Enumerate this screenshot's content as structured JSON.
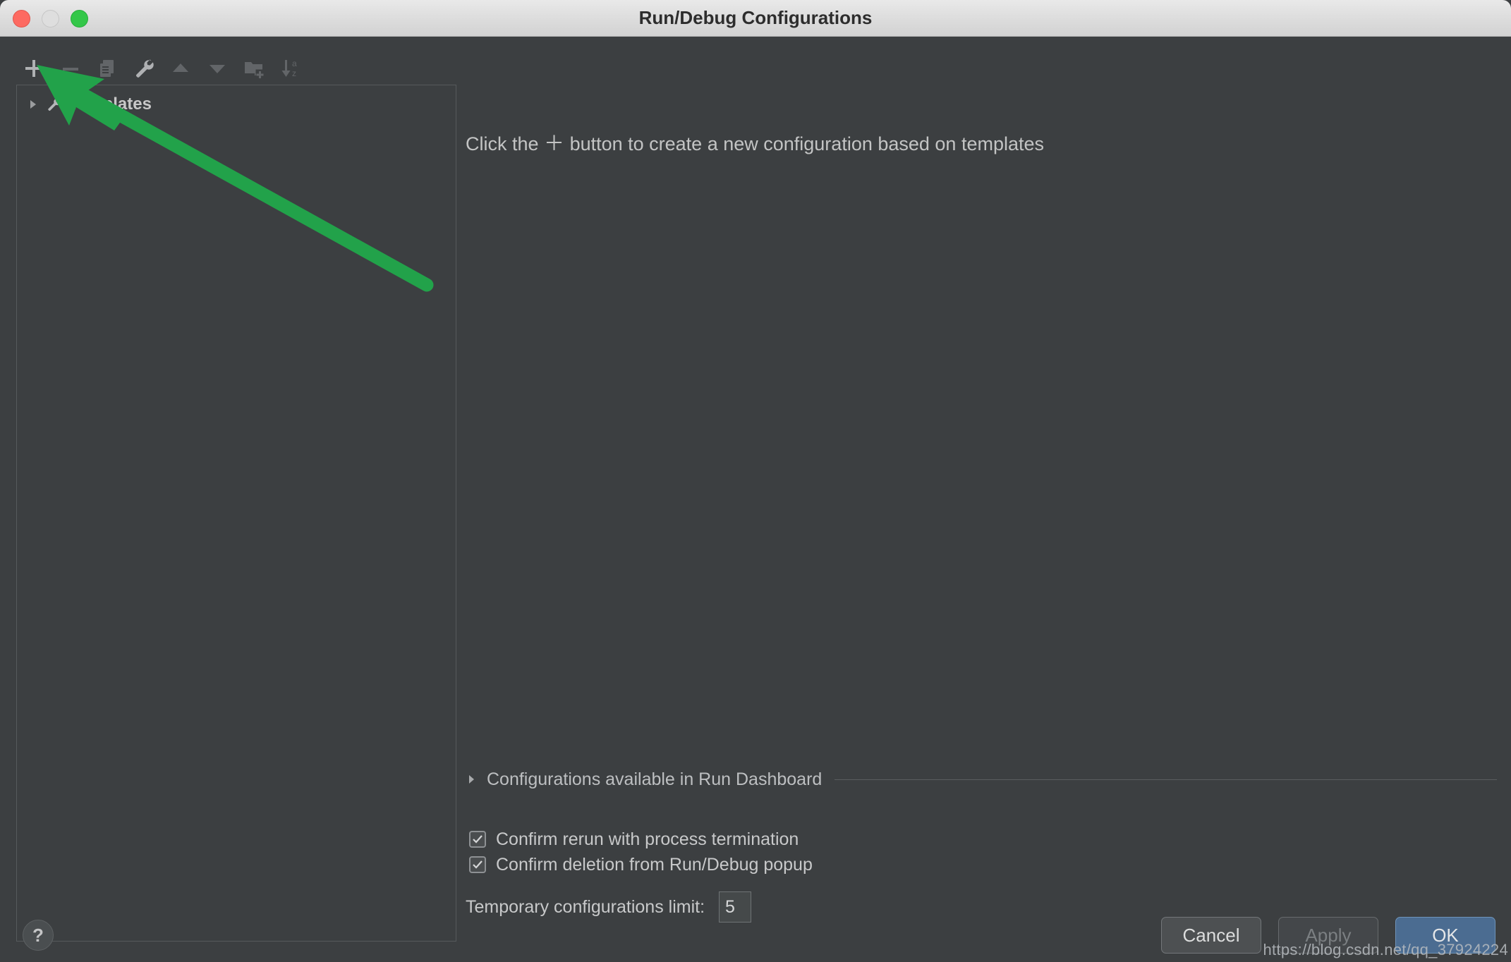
{
  "window": {
    "title": "Run/Debug Configurations",
    "traffic_lights": [
      "close-red",
      "minimize-grey",
      "maximize-green"
    ]
  },
  "toolbar": {
    "items": [
      {
        "name": "add-configuration-button",
        "icon": "plus-icon",
        "label": "+",
        "enabled": true
      },
      {
        "name": "remove-configuration-button",
        "icon": "minus-icon",
        "label": "−",
        "enabled": false
      },
      {
        "name": "copy-configuration-button",
        "icon": "copy-icon",
        "label": "Copy",
        "enabled": false
      },
      {
        "name": "edit-templates-button",
        "icon": "wrench-icon",
        "label": "Edit Templates",
        "enabled": true
      },
      {
        "name": "move-up-button",
        "icon": "triangle-up-icon",
        "label": "Move Up",
        "enabled": false
      },
      {
        "name": "move-down-button",
        "icon": "triangle-down-icon",
        "label": "Move Down",
        "enabled": false
      },
      {
        "name": "new-folder-button",
        "icon": "folder-add-icon",
        "label": "New Folder",
        "enabled": false
      },
      {
        "name": "sort-button",
        "icon": "sort-az-icon",
        "label": "Sort Configurations",
        "enabled": false
      }
    ]
  },
  "tree": {
    "items": [
      {
        "label": "Templates",
        "expanded": false,
        "icon": "wrench-icon"
      }
    ]
  },
  "main": {
    "hint_prefix": "Click the ",
    "hint_plus": "＋",
    "hint_suffix": " button to create a new configuration based on templates"
  },
  "dashboard_section": {
    "label": "Configurations available in Run Dashboard",
    "expanded": false
  },
  "options": {
    "checkboxes": [
      {
        "label": "Confirm rerun with process termination",
        "checked": true
      },
      {
        "label": "Confirm deletion from Run/Debug popup",
        "checked": true
      }
    ],
    "temporary_limit_label": "Temporary configurations limit:",
    "temporary_limit_value": "5"
  },
  "footer": {
    "help_glyph": "?",
    "cancel_label": "Cancel",
    "apply_label": "Apply",
    "ok_label": "OK"
  },
  "watermark": "https://blog.csdn.net/qq_37924224",
  "colors": {
    "dialog_bg": "#3c3f41",
    "titlebar_bg": "#dcdcdc",
    "accent_ok": "#4b6c91",
    "annotation_green": "#22a24a",
    "text_primary": "#c8c9ca",
    "icon_enabled": "#afb1b3",
    "icon_disabled": "#626568"
  }
}
